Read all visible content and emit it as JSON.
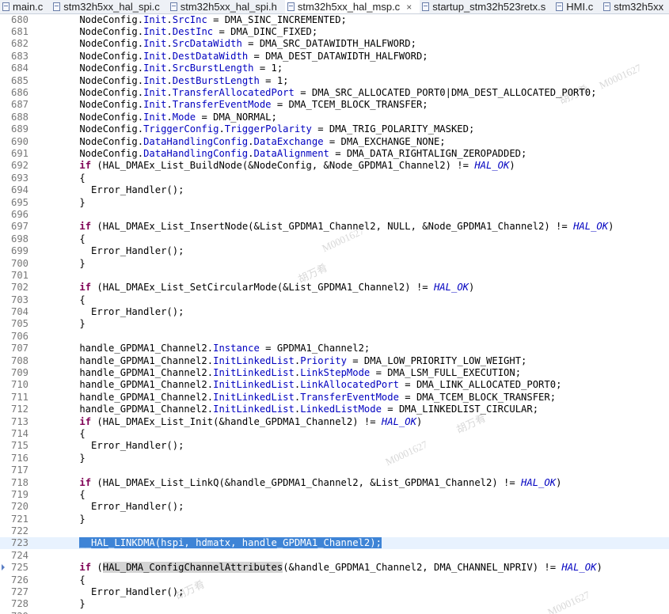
{
  "tabs": [
    {
      "label": "main.c",
      "active": false
    },
    {
      "label": "stm32h5xx_hal_spi.c",
      "active": false
    },
    {
      "label": "stm32h5xx_hal_spi.h",
      "active": false
    },
    {
      "label": "stm32h5xx_hal_msp.c",
      "active": true
    },
    {
      "label": "startup_stm32h523retx.s",
      "active": false
    },
    {
      "label": "HMI.c",
      "active": false
    },
    {
      "label": "stm32h5xx",
      "active": false
    }
  ],
  "close_glyph": "×",
  "watermark": {
    "code": "M0001627",
    "name": "胡万肴"
  },
  "lines": [
    {
      "n": "680",
      "t": [
        [
          "    NodeConfig.",
          ""
        ],
        [
          "Init",
          ".fld"
        ],
        [
          ".",
          ""
        ],
        [
          "SrcInc",
          "fld"
        ],
        [
          " = DMA_SINC_INCREMENTED;",
          ""
        ]
      ]
    },
    {
      "n": "681",
      "t": [
        [
          "    NodeConfig.",
          ""
        ],
        [
          "Init",
          "fld"
        ],
        [
          ".",
          ""
        ],
        [
          "DestInc",
          "fld"
        ],
        [
          " = DMA_DINC_FIXED;",
          ""
        ]
      ]
    },
    {
      "n": "682",
      "t": [
        [
          "    NodeConfig.",
          ""
        ],
        [
          "Init",
          "fld"
        ],
        [
          ".",
          ""
        ],
        [
          "SrcDataWidth",
          "fld"
        ],
        [
          " = DMA_SRC_DATAWIDTH_HALFWORD;",
          ""
        ]
      ]
    },
    {
      "n": "683",
      "t": [
        [
          "    NodeConfig.",
          ""
        ],
        [
          "Init",
          "fld"
        ],
        [
          ".",
          ""
        ],
        [
          "DestDataWidth",
          "fld"
        ],
        [
          " = DMA_DEST_DATAWIDTH_HALFWORD;",
          ""
        ]
      ]
    },
    {
      "n": "684",
      "t": [
        [
          "    NodeConfig.",
          ""
        ],
        [
          "Init",
          "fld"
        ],
        [
          ".",
          ""
        ],
        [
          "SrcBurstLength",
          "fld"
        ],
        [
          " = 1;",
          ""
        ]
      ]
    },
    {
      "n": "685",
      "t": [
        [
          "    NodeConfig.",
          ""
        ],
        [
          "Init",
          "fld"
        ],
        [
          ".",
          ""
        ],
        [
          "DestBurstLength",
          "fld"
        ],
        [
          " = 1;",
          ""
        ]
      ]
    },
    {
      "n": "686",
      "t": [
        [
          "    NodeConfig.",
          ""
        ],
        [
          "Init",
          "fld"
        ],
        [
          ".",
          ""
        ],
        [
          "TransferAllocatedPort",
          "fld"
        ],
        [
          " = DMA_SRC_ALLOCATED_PORT0|DMA_DEST_ALLOCATED_PORT0;",
          ""
        ]
      ]
    },
    {
      "n": "687",
      "t": [
        [
          "    NodeConfig.",
          ""
        ],
        [
          "Init",
          "fld"
        ],
        [
          ".",
          ""
        ],
        [
          "TransferEventMode",
          "fld"
        ],
        [
          " = DMA_TCEM_BLOCK_TRANSFER;",
          ""
        ]
      ]
    },
    {
      "n": "688",
      "t": [
        [
          "    NodeConfig.",
          ""
        ],
        [
          "Init",
          "fld"
        ],
        [
          ".",
          ""
        ],
        [
          "Mode",
          "fld"
        ],
        [
          " = DMA_NORMAL;",
          ""
        ]
      ]
    },
    {
      "n": "689",
      "t": [
        [
          "    NodeConfig.",
          ""
        ],
        [
          "TriggerConfig",
          "fld"
        ],
        [
          ".",
          ""
        ],
        [
          "TriggerPolarity",
          "fld"
        ],
        [
          " = DMA_TRIG_POLARITY_MASKED;",
          ""
        ]
      ]
    },
    {
      "n": "690",
      "t": [
        [
          "    NodeConfig.",
          ""
        ],
        [
          "DataHandlingConfig",
          "fld"
        ],
        [
          ".",
          ""
        ],
        [
          "DataExchange",
          "fld"
        ],
        [
          " = DMA_EXCHANGE_NONE;",
          ""
        ]
      ]
    },
    {
      "n": "691",
      "t": [
        [
          "    NodeConfig.",
          ""
        ],
        [
          "DataHandlingConfig",
          "fld"
        ],
        [
          ".",
          ""
        ],
        [
          "DataAlignment",
          "fld"
        ],
        [
          " = DMA_DATA_RIGHTALIGN_ZEROPADDED;",
          ""
        ]
      ]
    },
    {
      "n": "692",
      "t": [
        [
          "    ",
          ""
        ],
        [
          "if",
          "kw"
        ],
        [
          " (HAL_DMAEx_List_BuildNode(&NodeConfig, &Node_GPDMA1_Channel2) != ",
          ""
        ],
        [
          "HAL_OK",
          "mac"
        ],
        [
          ")",
          ""
        ]
      ]
    },
    {
      "n": "693",
      "t": [
        [
          "    {",
          ""
        ]
      ]
    },
    {
      "n": "694",
      "t": [
        [
          "      Error_Handler();",
          ""
        ]
      ]
    },
    {
      "n": "695",
      "t": [
        [
          "    }",
          ""
        ]
      ]
    },
    {
      "n": "696",
      "t": []
    },
    {
      "n": "697",
      "t": [
        [
          "    ",
          ""
        ],
        [
          "if",
          "kw"
        ],
        [
          " (HAL_DMAEx_List_InsertNode(&List_GPDMA1_Channel2, NULL, &Node_GPDMA1_Channel2) != ",
          ""
        ],
        [
          "HAL_OK",
          "mac"
        ],
        [
          ")",
          ""
        ]
      ]
    },
    {
      "n": "698",
      "t": [
        [
          "    {",
          ""
        ]
      ]
    },
    {
      "n": "699",
      "t": [
        [
          "      Error_Handler();",
          ""
        ]
      ]
    },
    {
      "n": "700",
      "t": [
        [
          "    }",
          ""
        ]
      ]
    },
    {
      "n": "701",
      "t": []
    },
    {
      "n": "702",
      "t": [
        [
          "    ",
          ""
        ],
        [
          "if",
          "kw"
        ],
        [
          " (HAL_DMAEx_List_SetCircularMode(&List_GPDMA1_Channel2) != ",
          ""
        ],
        [
          "HAL_OK",
          "mac"
        ],
        [
          ")",
          ""
        ]
      ]
    },
    {
      "n": "703",
      "t": [
        [
          "    {",
          ""
        ]
      ]
    },
    {
      "n": "704",
      "t": [
        [
          "      Error_Handler();",
          ""
        ]
      ]
    },
    {
      "n": "705",
      "t": [
        [
          "    }",
          ""
        ]
      ]
    },
    {
      "n": "706",
      "t": []
    },
    {
      "n": "707",
      "t": [
        [
          "    handle_GPDMA1_Channel2.",
          ""
        ],
        [
          "Instance",
          "fld"
        ],
        [
          " = GPDMA1_Channel2;",
          ""
        ]
      ]
    },
    {
      "n": "708",
      "t": [
        [
          "    handle_GPDMA1_Channel2.",
          ""
        ],
        [
          "InitLinkedList",
          "fld"
        ],
        [
          ".",
          ""
        ],
        [
          "Priority",
          "fld"
        ],
        [
          " = DMA_LOW_PRIORITY_LOW_WEIGHT;",
          ""
        ]
      ]
    },
    {
      "n": "709",
      "t": [
        [
          "    handle_GPDMA1_Channel2.",
          ""
        ],
        [
          "InitLinkedList",
          "fld"
        ],
        [
          ".",
          ""
        ],
        [
          "LinkStepMode",
          "fld"
        ],
        [
          " = DMA_LSM_FULL_EXECUTION;",
          ""
        ]
      ]
    },
    {
      "n": "710",
      "t": [
        [
          "    handle_GPDMA1_Channel2.",
          ""
        ],
        [
          "InitLinkedList",
          "fld"
        ],
        [
          ".",
          ""
        ],
        [
          "LinkAllocatedPort",
          "fld"
        ],
        [
          " = DMA_LINK_ALLOCATED_PORT0;",
          ""
        ]
      ]
    },
    {
      "n": "711",
      "t": [
        [
          "    handle_GPDMA1_Channel2.",
          ""
        ],
        [
          "InitLinkedList",
          "fld"
        ],
        [
          ".",
          ""
        ],
        [
          "TransferEventMode",
          "fld"
        ],
        [
          " = DMA_TCEM_BLOCK_TRANSFER;",
          ""
        ]
      ]
    },
    {
      "n": "712",
      "t": [
        [
          "    handle_GPDMA1_Channel2.",
          ""
        ],
        [
          "InitLinkedList",
          "fld"
        ],
        [
          ".",
          ""
        ],
        [
          "LinkedListMode",
          "fld"
        ],
        [
          " = DMA_LINKEDLIST_CIRCULAR;",
          ""
        ]
      ]
    },
    {
      "n": "713",
      "t": [
        [
          "    ",
          ""
        ],
        [
          "if",
          "kw"
        ],
        [
          " (HAL_DMAEx_List_Init(&handle_GPDMA1_Channel2) != ",
          ""
        ],
        [
          "HAL_OK",
          "mac"
        ],
        [
          ")",
          ""
        ]
      ]
    },
    {
      "n": "714",
      "t": [
        [
          "    {",
          ""
        ]
      ]
    },
    {
      "n": "715",
      "t": [
        [
          "      Error_Handler();",
          ""
        ]
      ]
    },
    {
      "n": "716",
      "t": [
        [
          "    }",
          ""
        ]
      ]
    },
    {
      "n": "717",
      "t": []
    },
    {
      "n": "718",
      "t": [
        [
          "    ",
          ""
        ],
        [
          "if",
          "kw"
        ],
        [
          " (HAL_DMAEx_List_LinkQ(&handle_GPDMA1_Channel2, &List_GPDMA1_Channel2) != ",
          ""
        ],
        [
          "HAL_OK",
          "mac"
        ],
        [
          ")",
          ""
        ]
      ]
    },
    {
      "n": "719",
      "t": [
        [
          "    {",
          ""
        ]
      ]
    },
    {
      "n": "720",
      "t": [
        [
          "      Error_Handler();",
          ""
        ]
      ]
    },
    {
      "n": "721",
      "t": [
        [
          "    }",
          ""
        ]
      ]
    },
    {
      "n": "722",
      "t": []
    },
    {
      "n": "723",
      "current": true,
      "t": [
        [
          "    ",
          ""
        ],
        [
          "__HAL_LINKDMA(hspi, hdmatx, handle_GPDMA1_Channel2);",
          "sel"
        ]
      ]
    },
    {
      "n": "724",
      "t": []
    },
    {
      "n": "725",
      "marker": true,
      "t": [
        [
          "    ",
          ""
        ],
        [
          "if",
          "kw"
        ],
        [
          " (",
          ""
        ],
        [
          "HAL_DMA_ConfigChannelAttributes",
          "hl"
        ],
        [
          "(&handle_GPDMA1_Channel2, DMA_CHANNEL_NPRIV) != ",
          ""
        ],
        [
          "HAL_OK",
          "mac"
        ],
        [
          ")",
          ""
        ]
      ]
    },
    {
      "n": "726",
      "t": [
        [
          "    {",
          ""
        ]
      ]
    },
    {
      "n": "727",
      "t": [
        [
          "      Error_Handler();",
          ""
        ]
      ]
    },
    {
      "n": "728",
      "t": [
        [
          "    }",
          ""
        ]
      ]
    },
    {
      "n": "729",
      "t": []
    }
  ]
}
